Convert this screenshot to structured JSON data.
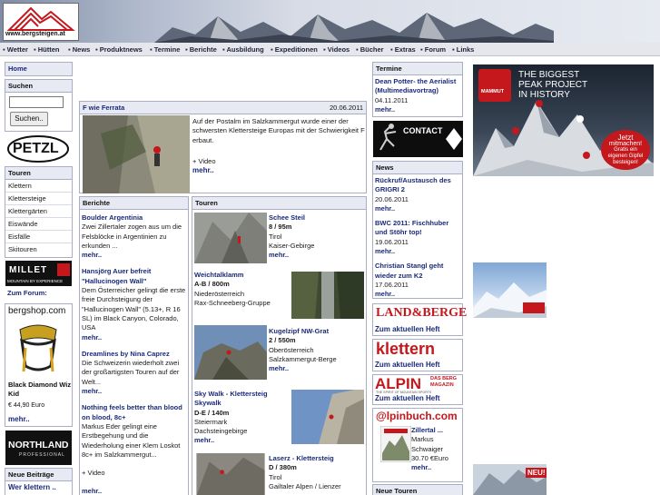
{
  "site": {
    "url": "www.bergsteigen.at"
  },
  "nav": [
    "Wetter",
    "Hütten",
    "News",
    "Produktnews",
    "Termine",
    "Berichte",
    "Ausbildung",
    "Expeditionen",
    "Videos",
    "Bücher",
    "Extras",
    "Forum",
    "Links"
  ],
  "sidebar": {
    "home": "Home",
    "search_title": "Suchen",
    "search_button": "Suchen..",
    "touren_title": "Touren",
    "touren": [
      "Klettern",
      "Klettersteige",
      "Klettergärten",
      "Eiswände",
      "Eisfälle",
      "Skitouren"
    ],
    "forum_link": "Zum Forum:",
    "shop_product": "Black Diamond Wiz Kid",
    "shop_price": "€ 44,90 Euro",
    "more": "mehr..",
    "neue_beitraege": "Neue Beiträge",
    "neue_beitraege_first": "Wer klettern .."
  },
  "feature": {
    "title": "F wie Ferrata",
    "date": "20.06.2011",
    "text": "Auf der Postalm im Salzkammergut wurde einer der schwersten Klettersteige Europas mit der Schwierigkeit F erbaut.",
    "extra": "+ Video",
    "more": "mehr.."
  },
  "berichte": {
    "title": "Berichte",
    "items": [
      {
        "title": "Boulder Argentinia",
        "text": "Zwei Zillertaler zogen aus um die Felsblöcke in Argentinien zu erkunden ...",
        "more": "mehr.."
      },
      {
        "title": "Hansjörg Auer befreit \"Hallucinogen Wall\"",
        "text": "Dem Österreicher gelingt die erste freie Durchsteigung der \"Hallucinogen Wall\" (5.13+, R 16 SL) im Black Canyon, Colorado, USA",
        "more": "mehr.."
      },
      {
        "title": "Dreamlines by Nina Caprez",
        "text": "Die Schweizerin wiederholt zwei der großartigsten Touren auf der Welt...",
        "more": "mehr.."
      },
      {
        "title": "Nothing feels better than blood on blood, 8c+",
        "text": "Markus Eder gelingt eine Erstbegehung und die Wiederholung einer Klem Loskot 8c+ im Salzkammergut...",
        "extra": "+ Video",
        "more": "mehr.."
      }
    ]
  },
  "touren": {
    "title": "Touren",
    "items": [
      {
        "title": "Schee Steil",
        "grade": "8 / 95m",
        "region": "Tirol",
        "area": "Kaiser-Gebirge",
        "more": "mehr.."
      },
      {
        "title": "Weichtalklamm",
        "grade": "A-B / 800m",
        "region": "Niederösterreich",
        "area": "Rax-Schneeberg-Gruppe",
        "more": "mehr.."
      },
      {
        "title": "Kugelzipf NW-Grat",
        "grade": "2 / 550m",
        "region": "Oberösterreich",
        "area": "Salzkammergut-Berge",
        "more": "mehr.."
      },
      {
        "title": "Sky Walk - Klettersteig Skywalk",
        "grade": "D-E / 140m",
        "region": "Steiermark",
        "area": "Dachsteingebirge",
        "more": "mehr.."
      },
      {
        "title": "Laserz - Klettersteig",
        "grade": "D / 380m",
        "region": "Tirol",
        "area": "Gailtaler Alpen / Lienzer"
      }
    ]
  },
  "termine": {
    "title": "Termine",
    "item_title": "Dean Potter- the Aerialist (Multimediavortrag)",
    "item_date": "04.11.2011",
    "more": "mehr.."
  },
  "news": {
    "title": "News",
    "items": [
      {
        "title": "Rückruf/Austausch des GRIGRI 2",
        "date": "20.06.2011",
        "more": "mehr.."
      },
      {
        "title": "BWC 2011: Fischhuber und Stöhr top!",
        "date": "19.06.2011",
        "more": "mehr.."
      },
      {
        "title": "Christian Stangl geht wieder zum K2",
        "date": "17.06.2011",
        "more": "mehr.."
      }
    ]
  },
  "magazines": {
    "land_berge": "LAND&BERGE",
    "klettern": "klettern",
    "alpin": "ALPIN",
    "alpin_sub1": "DAS BERG",
    "alpin_sub2": "MAGAZIN",
    "alpin_tag": "THE SPIRIT OF MOUNTAIN SPORTS",
    "link": "Zum aktuellen Heft"
  },
  "alpinbuch": {
    "logo": "@lpinbuch.com",
    "book": "Zillertal ...",
    "author": "Markus Schwaiger",
    "price": "30.70 €Euro",
    "more": "mehr.."
  },
  "neue_touren": "Neue Touren",
  "ads": {
    "contact": "CONTACT",
    "mammut_line1": "THE BIGGEST",
    "mammut_line2": "PEAK PROJECT",
    "mammut_line3": "IN HISTORY",
    "mammut_badge1": "Jetzt",
    "mammut_badge2": "mitmachen!",
    "mammut_badge3": "Gratis ein",
    "mammut_badge4": "eigenen Gipfel",
    "mammut_badge5": "besteigen!",
    "mammut_logo": "MAMMUT",
    "petzl": "PETZL",
    "millet": "MILLET",
    "millet_sub": "MOUNTAIN BY EXPERIENCE",
    "bergshop": "bergshop.com",
    "northland": "NORTHLAND",
    "northland_sub": "PROFESSIONAL",
    "neu": "NEU!"
  },
  "colors": {
    "link": "#1a2a7a",
    "box_border": "#a9aec4",
    "box_header": "#e7e9f3",
    "mammut_red": "#c4181c"
  }
}
